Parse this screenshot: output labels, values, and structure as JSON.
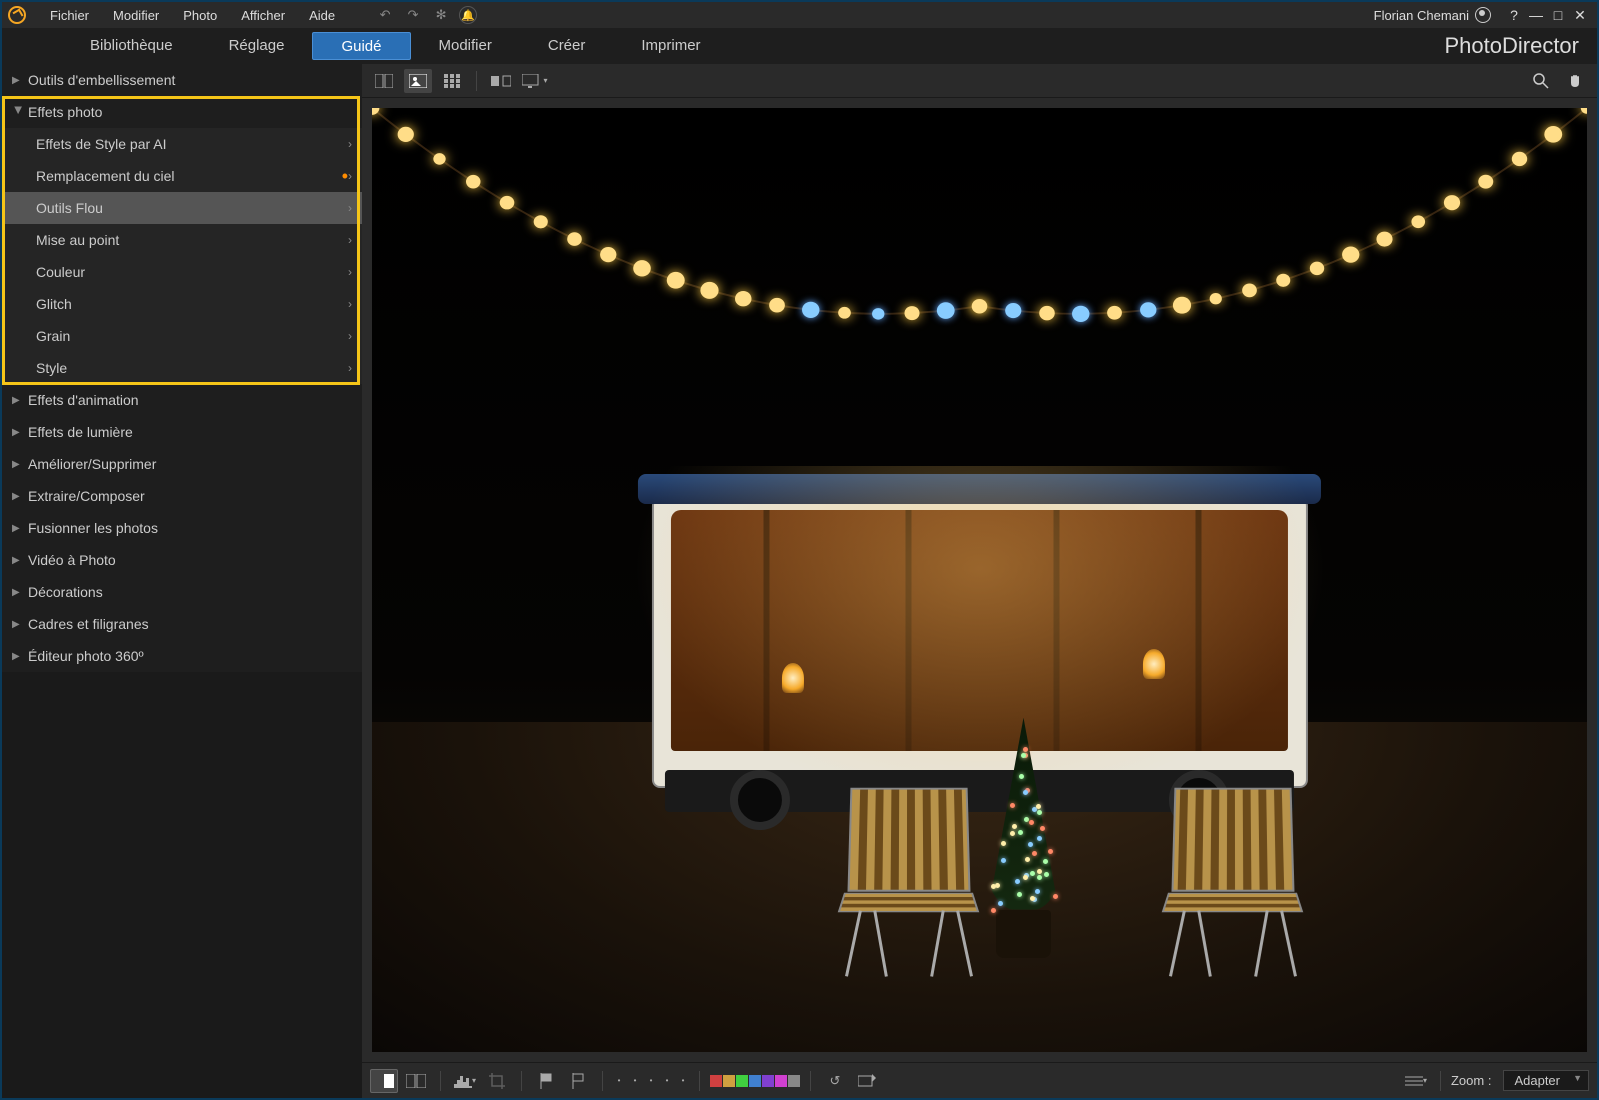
{
  "menubar": {
    "items": [
      "Fichier",
      "Modifier",
      "Photo",
      "Afficher",
      "Aide"
    ],
    "user_name": "Florian Chemani"
  },
  "tabs": {
    "items": [
      "Bibliothèque",
      "Réglage",
      "Guidé",
      "Modifier",
      "Créer",
      "Imprimer"
    ],
    "active_index": 2,
    "brand": "PhotoDirector"
  },
  "sidebar": {
    "sections": [
      {
        "label": "Outils d'embellissement",
        "expanded": false
      },
      {
        "label": "Effets photo",
        "expanded": true,
        "highlighted": true,
        "children": [
          {
            "label": "Effets de Style par AI"
          },
          {
            "label": "Remplacement du ciel",
            "badge": true
          },
          {
            "label": "Outils Flou",
            "selected": true
          },
          {
            "label": "Mise au point"
          },
          {
            "label": "Couleur"
          },
          {
            "label": "Glitch"
          },
          {
            "label": "Grain"
          },
          {
            "label": "Style"
          }
        ]
      },
      {
        "label": "Effets d'animation",
        "expanded": false
      },
      {
        "label": "Effets de lumière",
        "expanded": false
      },
      {
        "label": "Améliorer/Supprimer",
        "expanded": false
      },
      {
        "label": "Extraire/Composer",
        "expanded": false
      },
      {
        "label": "Fusionner les photos",
        "expanded": false
      },
      {
        "label": "Vidéo à Photo",
        "expanded": false
      },
      {
        "label": "Décorations",
        "expanded": false
      },
      {
        "label": "Cadres et filigranes",
        "expanded": false
      },
      {
        "label": "Éditeur photo 360º",
        "expanded": false
      }
    ]
  },
  "viewer_toolbar": {
    "view_modes": [
      "compare-icon",
      "single-icon",
      "grid-icon"
    ],
    "active_view": 1
  },
  "bottom_toolbar": {
    "swatch_colors": [
      "#d04040",
      "#d0a040",
      "#40d040",
      "#4080d0",
      "#8040d0",
      "#d040d0",
      "#888"
    ],
    "zoom_label": "Zoom :",
    "zoom_value": "Adapter"
  }
}
